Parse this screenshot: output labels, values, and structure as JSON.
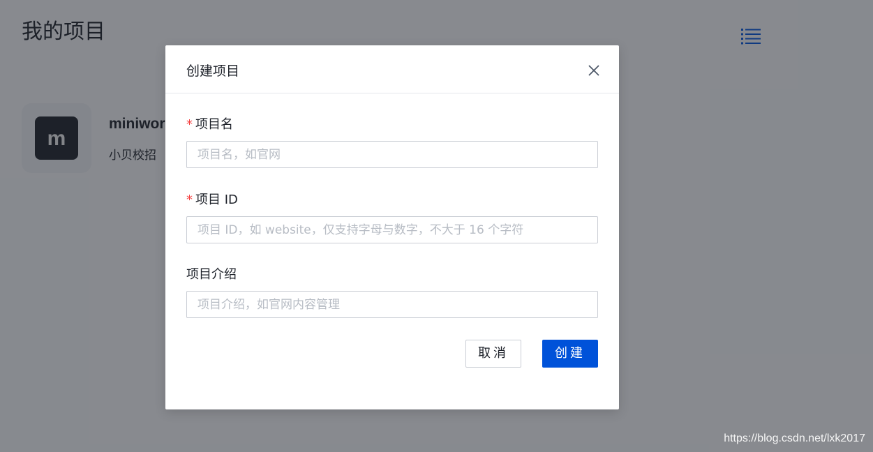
{
  "page": {
    "title": "我的项目",
    "menu_icon": "list-icon"
  },
  "project_card": {
    "logo_letter": "m",
    "name": "miniwor",
    "description": "小贝校招"
  },
  "modal": {
    "title": "创建项目",
    "close_icon": "close-icon",
    "fields": [
      {
        "label": "项目名",
        "required": true,
        "required_mark": "*",
        "value": "",
        "placeholder": "项目名，如官网"
      },
      {
        "label": "项目 ID",
        "required": true,
        "required_mark": "*",
        "value": "",
        "placeholder": "项目 ID，如 website，仅支持字母与数字，不大于 16 个字符"
      },
      {
        "label": "项目介绍",
        "required": false,
        "value": "",
        "placeholder": "项目介绍，如官网内容管理"
      }
    ],
    "cancel_label": "取消",
    "create_label": "创建"
  },
  "watermark": "https://blog.csdn.net/lxk2017",
  "colors": {
    "primary": "#0052d9",
    "required": "#f53f3f",
    "mask": "rgba(29,33,41,0.5)"
  }
}
